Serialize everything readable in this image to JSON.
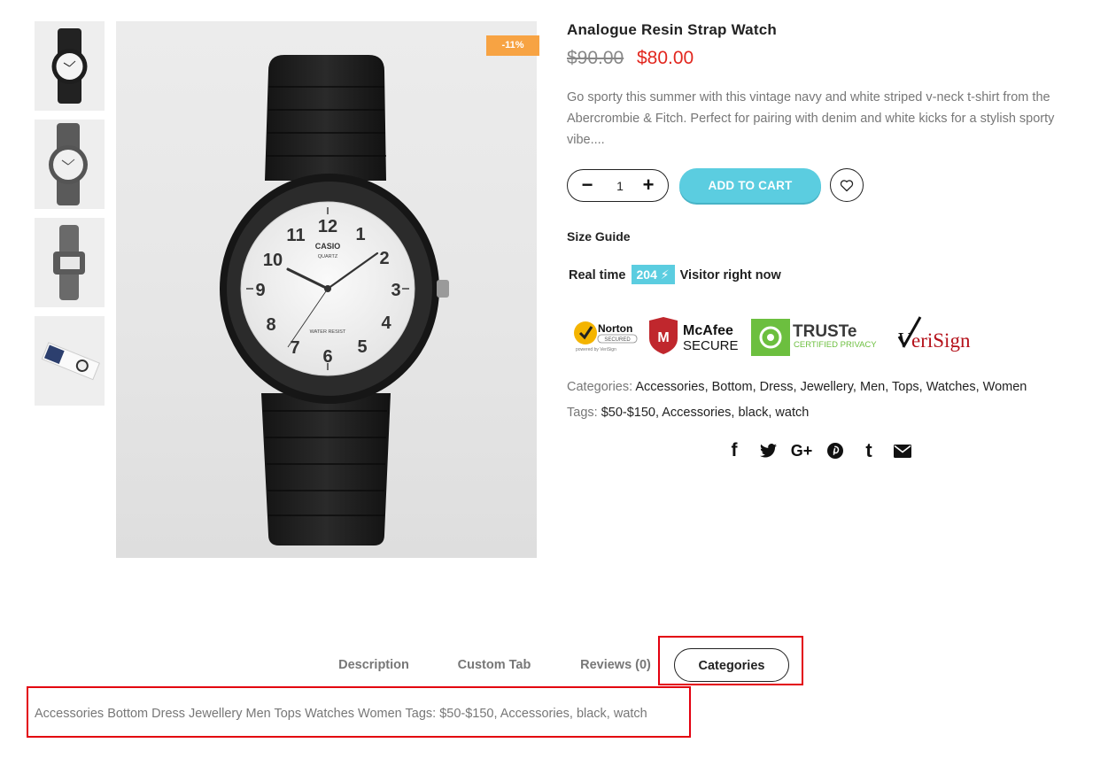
{
  "product": {
    "title": "Analogue Resin Strap Watch",
    "price_old": "$90.00",
    "price_new": "$80.00",
    "sale_badge": "-11%",
    "description": "Go sporty this summer with this vintage navy and white striped v-neck t-shirt from the Abercrombie & Fitch. Perfect for pairing with denim and white kicks for a stylish sporty vibe....",
    "watch_face": {
      "brand": "CASIO",
      "model": "QUARTZ",
      "resist": "WATER RESIST",
      "numbers": [
        "12",
        "1",
        "2",
        "3",
        "4",
        "5",
        "6",
        "7",
        "8",
        "9",
        "10",
        "11"
      ]
    }
  },
  "thumbnails": [
    "front view",
    "angle view",
    "side view",
    "box view"
  ],
  "cart": {
    "quantity": "1",
    "minus_symbol": "−",
    "plus_symbol": "+",
    "add_to_cart": "ADD TO CART"
  },
  "size_guide": "Size Guide",
  "realtime": {
    "prefix": "Real time",
    "count": "204",
    "suffix": "Visitor right now"
  },
  "trust_badges": {
    "norton": {
      "name": "Norton",
      "sub": "SECURED",
      "powered": "powered by VeriSign"
    },
    "mcafee": {
      "name": "McAfee",
      "sub": "SECURE"
    },
    "truste": {
      "name": "TRUSTe",
      "sub": "CERTIFIED PRIVACY"
    },
    "verisign": {
      "name": "VeriSign"
    }
  },
  "meta": {
    "categories_label": "Categories:",
    "categories": [
      "Accessories",
      "Bottom",
      "Dress",
      "Jewellery",
      "Men",
      "Tops",
      "Watches",
      "Women"
    ],
    "tags_label": "Tags:",
    "tags": [
      "$50-$150",
      "Accessories",
      "black",
      "watch"
    ]
  },
  "share_icons": [
    "facebook-icon",
    "twitter-icon",
    "google-plus-icon",
    "pinterest-icon",
    "tumblr-icon",
    "email-icon"
  ],
  "share_glyphs": {
    "facebook": "f",
    "google": "G+",
    "tumblr": "t"
  },
  "tabs": [
    "Description",
    "Custom Tab",
    "Reviews (0)",
    "Categories"
  ],
  "tab_content": "Accessories Bottom Dress Jewellery Men Tops Watches Women Tags: $50-$150, Accessories, black, watch",
  "colors": {
    "accent": "#5bcde0",
    "sale_badge": "#f7a343",
    "price_new": "#e2271f",
    "highlight": "#e3000f"
  }
}
